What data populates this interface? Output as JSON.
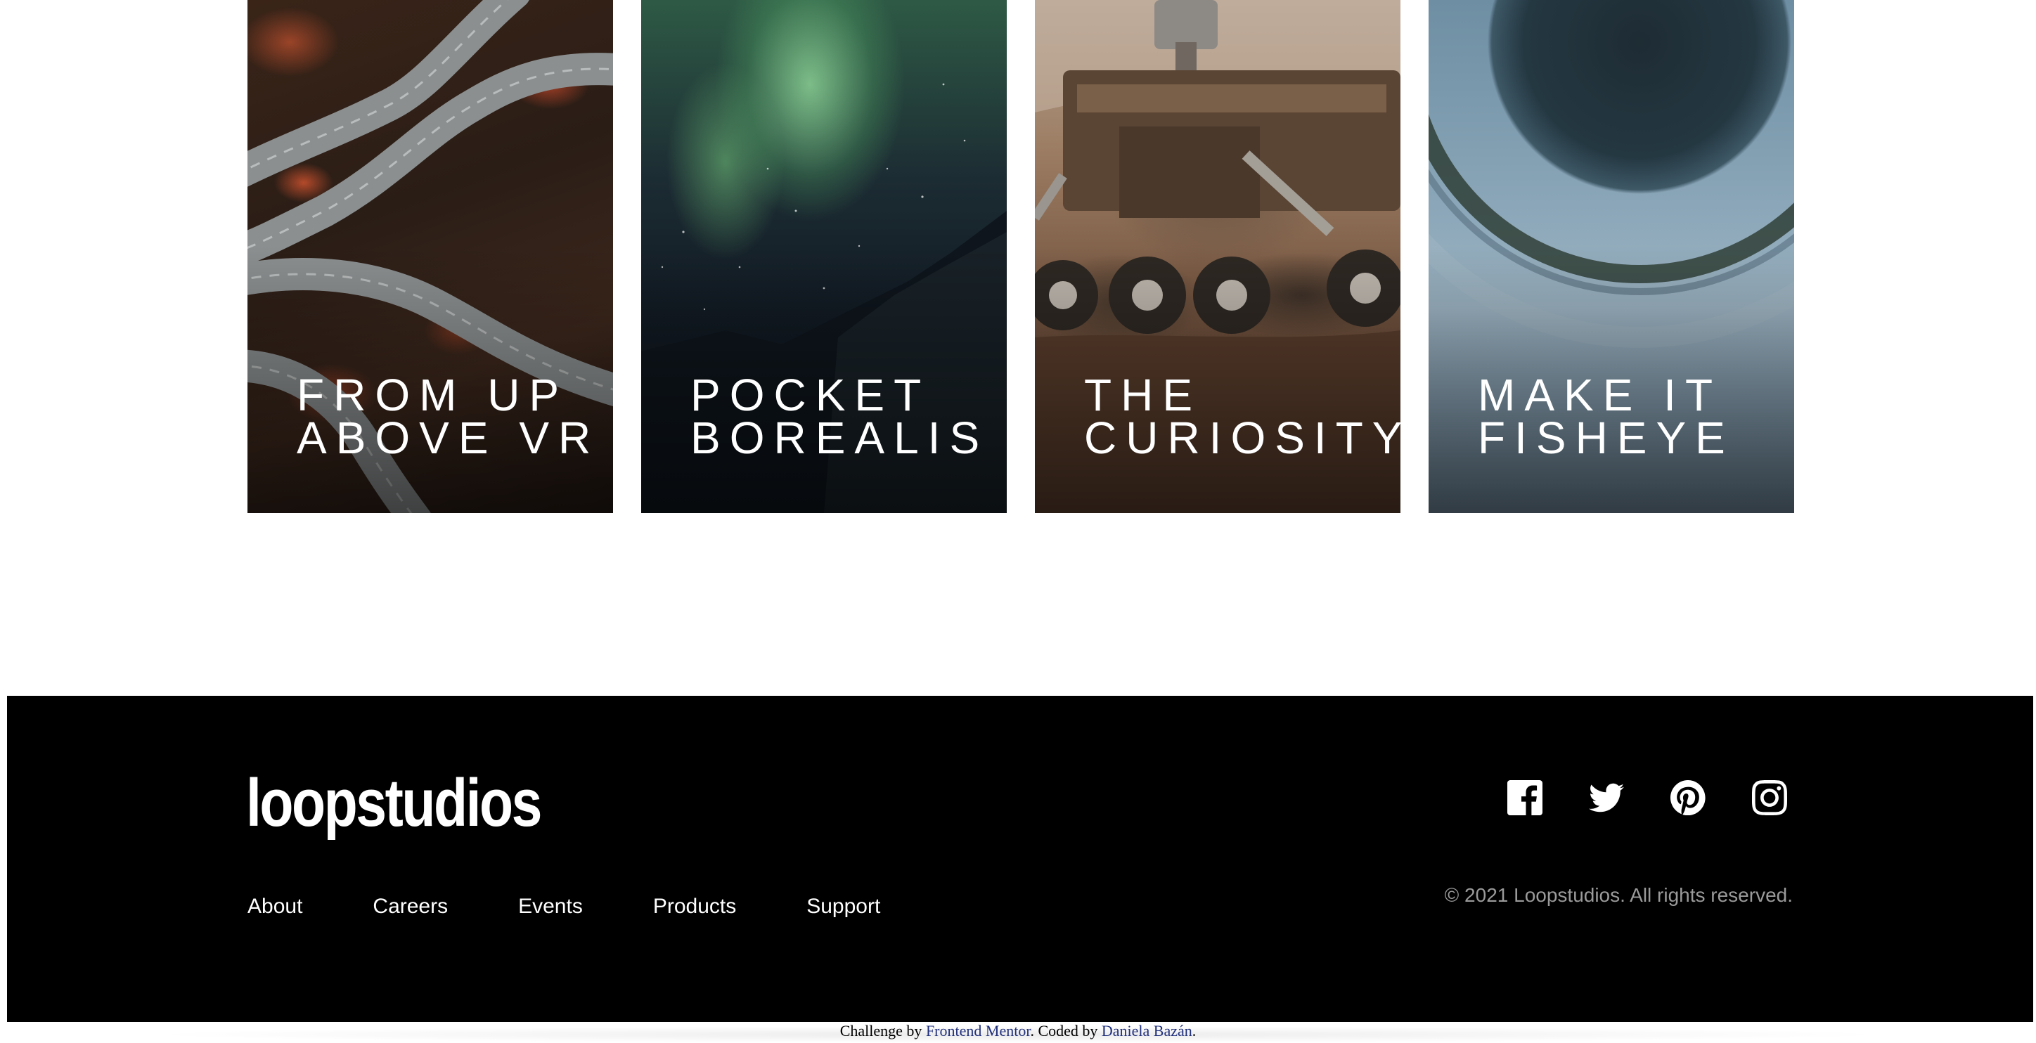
{
  "creations": {
    "items": [
      {
        "line1": "FROM UP",
        "line2": "ABOVE VR"
      },
      {
        "line1": "POCKET",
        "line2": "BOREALIS"
      },
      {
        "line1": "THE",
        "line2": "CURIOSITY"
      },
      {
        "line1": "MAKE IT",
        "line2": "FISHEYE"
      }
    ]
  },
  "footer": {
    "logo": "loopstudios",
    "social": [
      "facebook-icon",
      "twitter-icon",
      "pinterest-icon",
      "instagram-icon"
    ],
    "nav": [
      "About",
      "Careers",
      "Events",
      "Products",
      "Support"
    ],
    "copyright": "© 2021 Loopstudios. All rights reserved.",
    "colors": {
      "background": "#000000",
      "text": "#ffffff",
      "muted": "#9a9a9a"
    }
  },
  "attribution": {
    "prefix": "Challenge by ",
    "link1": "Frontend Mentor",
    "middle": ". Coded by ",
    "link2": "Daniela Bazán",
    "suffix": "."
  }
}
